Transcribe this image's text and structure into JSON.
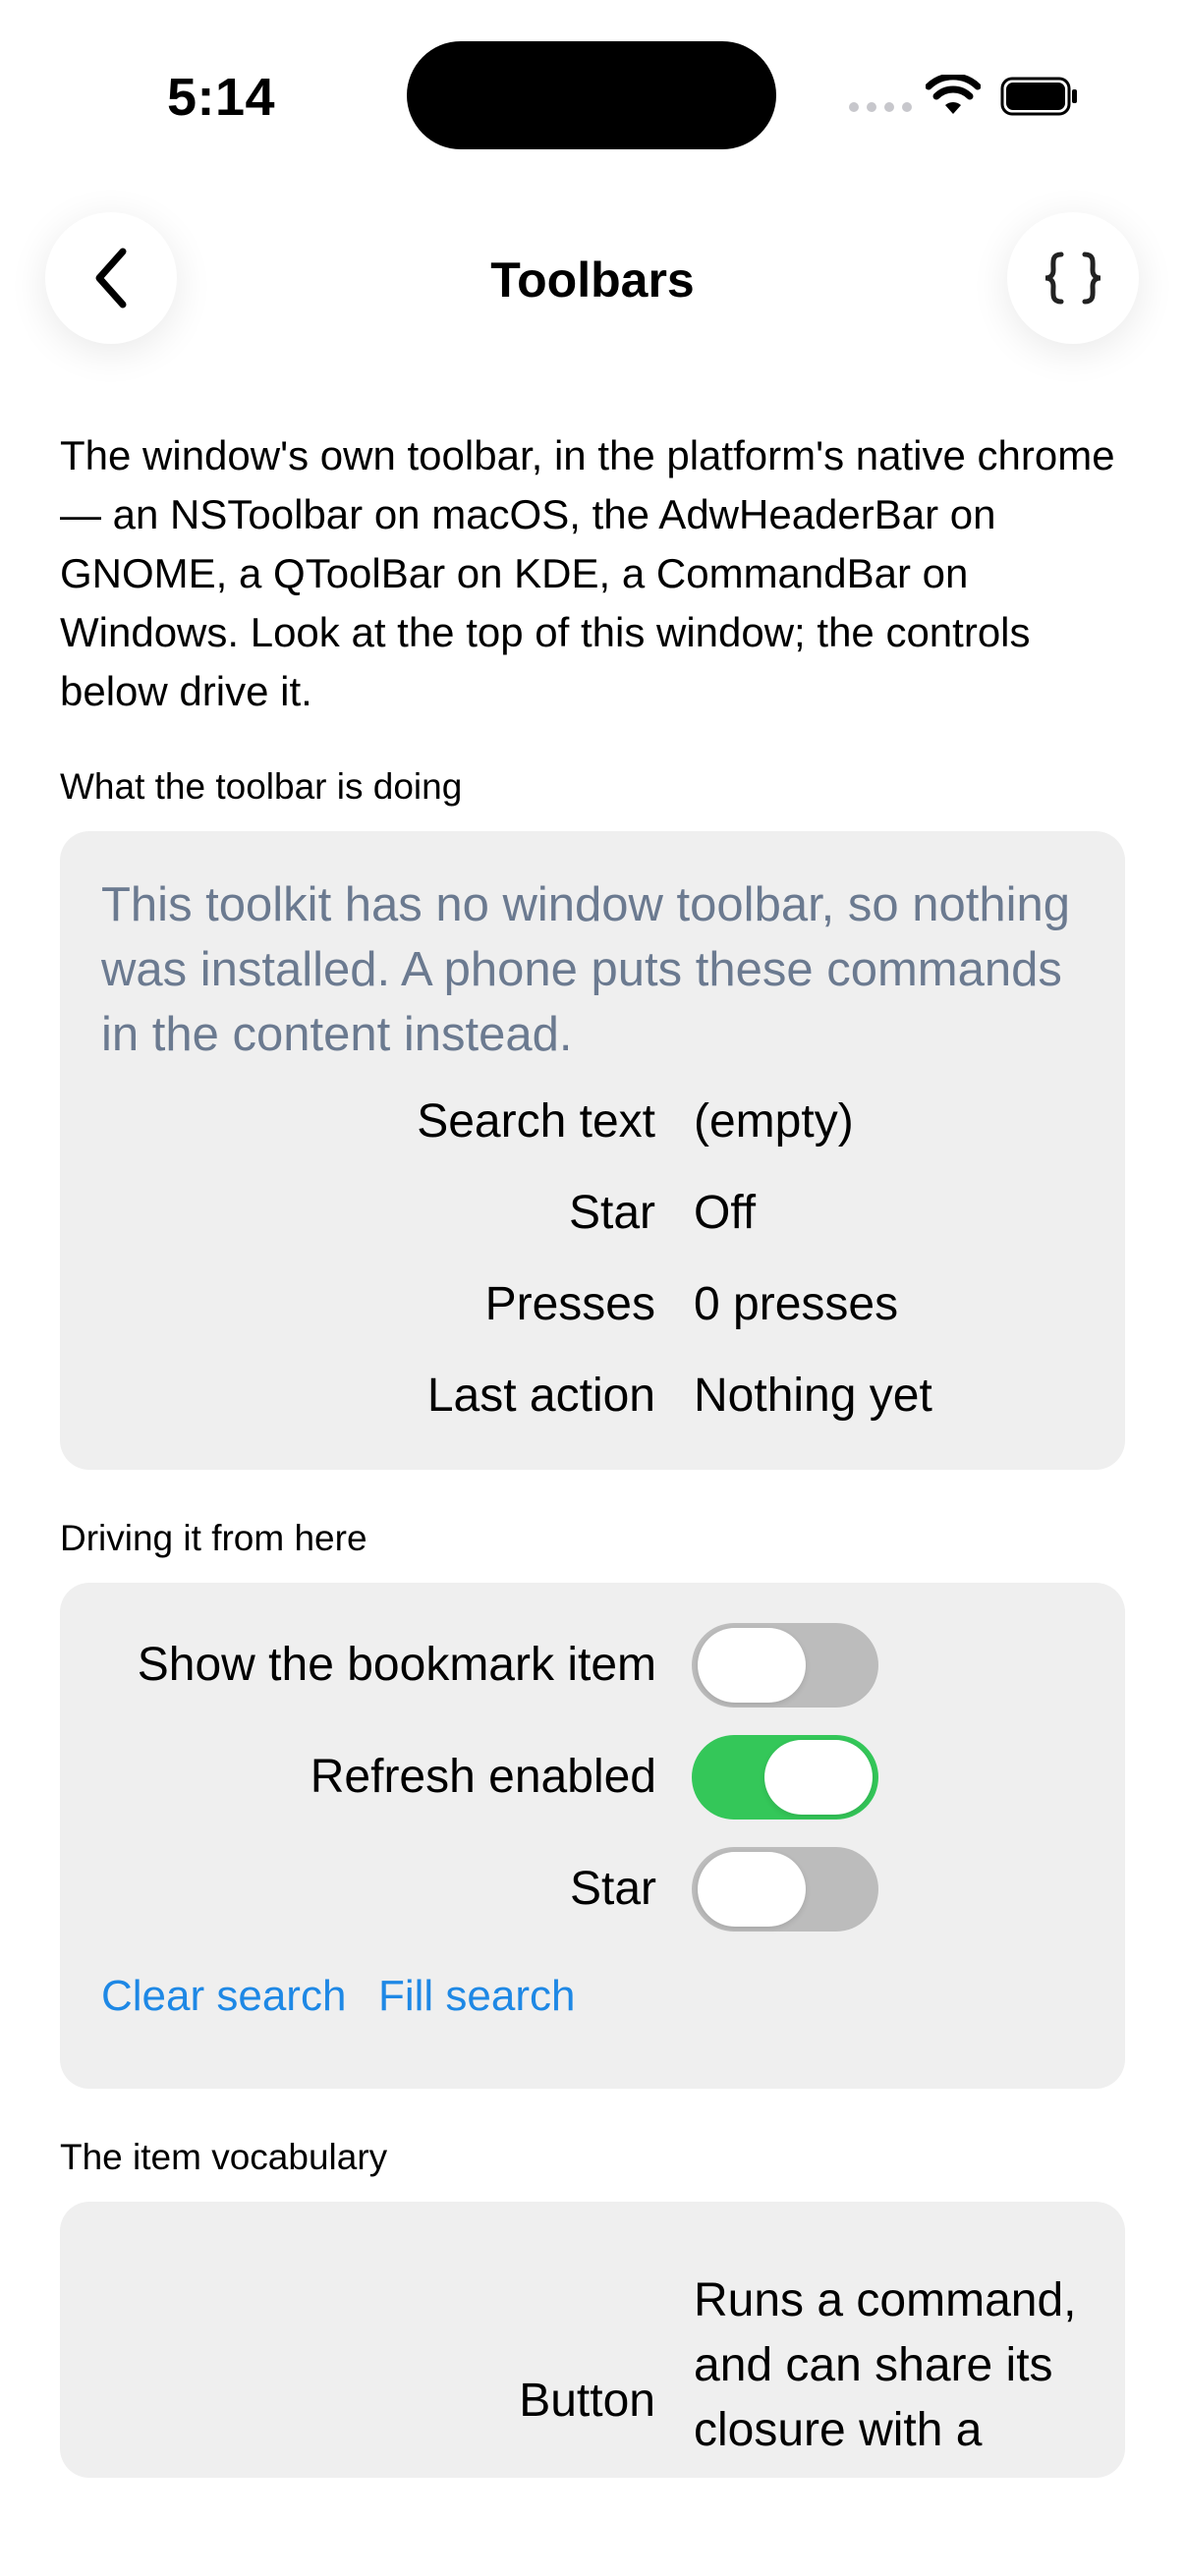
{
  "status_bar": {
    "time": "5:14"
  },
  "nav": {
    "title": "Toolbars",
    "back_icon": "chevron-left-icon",
    "code_icon": "curly-braces-icon"
  },
  "intro": "The window's own toolbar, in the platform's native chrome — an NSToolbar on macOS, the AdwHeaderBar on GNOME, a QToolBar on KDE, a CommandBar on Windows. Look at the top of this window; the controls below drive it.",
  "status_section": {
    "header": "What the toolbar is doing",
    "note": "This toolkit has no window toolbar, so nothing was installed. A phone puts these commands in the content instead.",
    "rows": [
      {
        "key": "Search text",
        "value": "(empty)"
      },
      {
        "key": "Star",
        "value": "Off"
      },
      {
        "key": "Presses",
        "value": "0 presses"
      },
      {
        "key": "Last action",
        "value": "Nothing yet"
      }
    ]
  },
  "controls_section": {
    "header": "Driving it from here",
    "toggles": [
      {
        "label": "Show the bookmark item",
        "on": false
      },
      {
        "label": "Refresh enabled",
        "on": true
      },
      {
        "label": "Star",
        "on": false
      }
    ],
    "clear_search": "Clear search",
    "fill_search": "Fill search"
  },
  "vocab_section": {
    "header": "The item vocabulary",
    "items": [
      {
        "key": "Button",
        "desc": "Runs a command, and can share its closure with a"
      }
    ]
  },
  "colors": {
    "accent": "#1e88e5",
    "toggle_on": "#34c759",
    "card_bg": "#efefef",
    "note_text": "#6b7a90"
  }
}
